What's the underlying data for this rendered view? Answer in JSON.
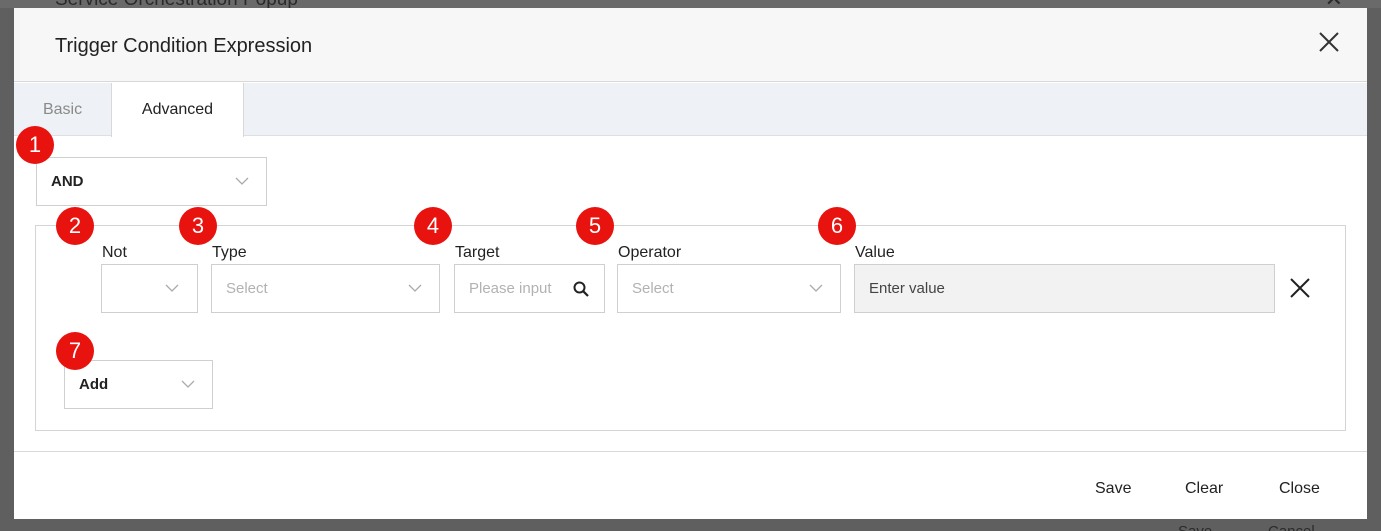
{
  "background_window": {
    "title": "Service Orchestration Popup",
    "save_label": "Save",
    "cancel_label": "Cancel"
  },
  "dialog": {
    "title": "Trigger Condition Expression",
    "close_icon": "close-icon"
  },
  "tabs": [
    {
      "label": "Basic",
      "active": false
    },
    {
      "label": "Advanced",
      "active": true
    }
  ],
  "logic_select": {
    "value": "AND"
  },
  "condition_row": {
    "not": {
      "label": "Not",
      "value": ""
    },
    "type": {
      "label": "Type",
      "placeholder": "Select"
    },
    "target": {
      "label": "Target",
      "placeholder": "Please input"
    },
    "operator": {
      "label": "Operator",
      "placeholder": "Select"
    },
    "value": {
      "label": "Value",
      "placeholder": "Enter value"
    }
  },
  "add_select": {
    "value": "Add"
  },
  "footer": {
    "save_label": "Save",
    "clear_label": "Clear",
    "close_label": "Close"
  },
  "badges": [
    "1",
    "2",
    "3",
    "4",
    "5",
    "6",
    "7"
  ],
  "colors": {
    "badge": "#e8120f",
    "overlay": "#5f5f5f",
    "value_field_bg": "#f2f2f2"
  }
}
